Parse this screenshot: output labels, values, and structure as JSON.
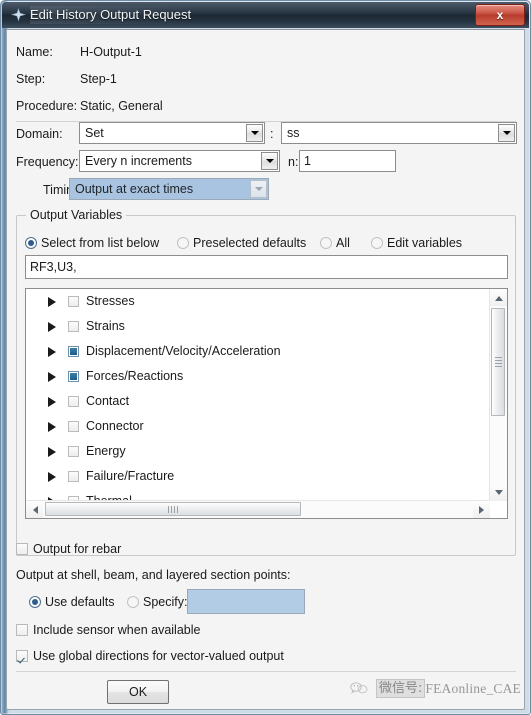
{
  "window": {
    "title": "Edit History Output Request",
    "icon": "abaqus-star-icon",
    "close_label": "x"
  },
  "header": {
    "rows": [
      {
        "label": "Name:",
        "value": "H-Output-1"
      },
      {
        "label": "Step:",
        "value": "Step-1"
      },
      {
        "label": "Procedure:",
        "value": "Static, General"
      }
    ]
  },
  "form": {
    "domain_label": "Domain:",
    "domain_value": "Set",
    "domain_separator": ":",
    "domain_set_value": "ss",
    "frequency_label": "Frequency:",
    "frequency_value": "Every n increments",
    "n_label": "n:",
    "n_value": "1",
    "timing_label": "Timing:",
    "timing_value": "Output at exact times"
  },
  "output_variables": {
    "group_title": "Output Variables",
    "modes": [
      {
        "label": "Select from list below",
        "selected": true
      },
      {
        "label": "Preselected defaults",
        "selected": false
      },
      {
        "label": "All",
        "selected": false
      },
      {
        "label": "Edit variables",
        "selected": false
      }
    ],
    "variables_field": "RF3,U3,",
    "tree": [
      {
        "label": "Stresses",
        "state": "unchecked"
      },
      {
        "label": "Strains",
        "state": "unchecked"
      },
      {
        "label": "Displacement/Velocity/Acceleration",
        "state": "partial"
      },
      {
        "label": "Forces/Reactions",
        "state": "partial"
      },
      {
        "label": "Contact",
        "state": "unchecked"
      },
      {
        "label": "Connector",
        "state": "unchecked"
      },
      {
        "label": "Energy",
        "state": "unchecked"
      },
      {
        "label": "Failure/Fracture",
        "state": "unchecked"
      },
      {
        "label": "Thermal",
        "state": "unchecked"
      }
    ]
  },
  "bottom": {
    "output_for_rebar": {
      "label": "Output for rebar",
      "checked": false
    },
    "section_points_label": "Output at shell, beam, and layered section points:",
    "use_defaults": {
      "label": "Use defaults",
      "selected": true
    },
    "specify": {
      "label": "Specify:",
      "selected": false,
      "value": ""
    },
    "include_sensor": {
      "label": "Include sensor when available",
      "checked": false
    },
    "use_global_directions": {
      "label": "Use global directions for vector-valued output",
      "checked": true
    }
  },
  "footer": {
    "ok_label": "OK"
  },
  "watermark": {
    "cn_text": "微信号:",
    "id_text": "FEAonline_CAE"
  },
  "colors": {
    "titlebar": "#24323f",
    "close_red": "#c2503c",
    "highlight_blue": "#a9c4e0",
    "specify_blue": "#b3cce6",
    "checkbox_blue": "#2a6d99",
    "radio_blue": "#2d5d8c"
  }
}
